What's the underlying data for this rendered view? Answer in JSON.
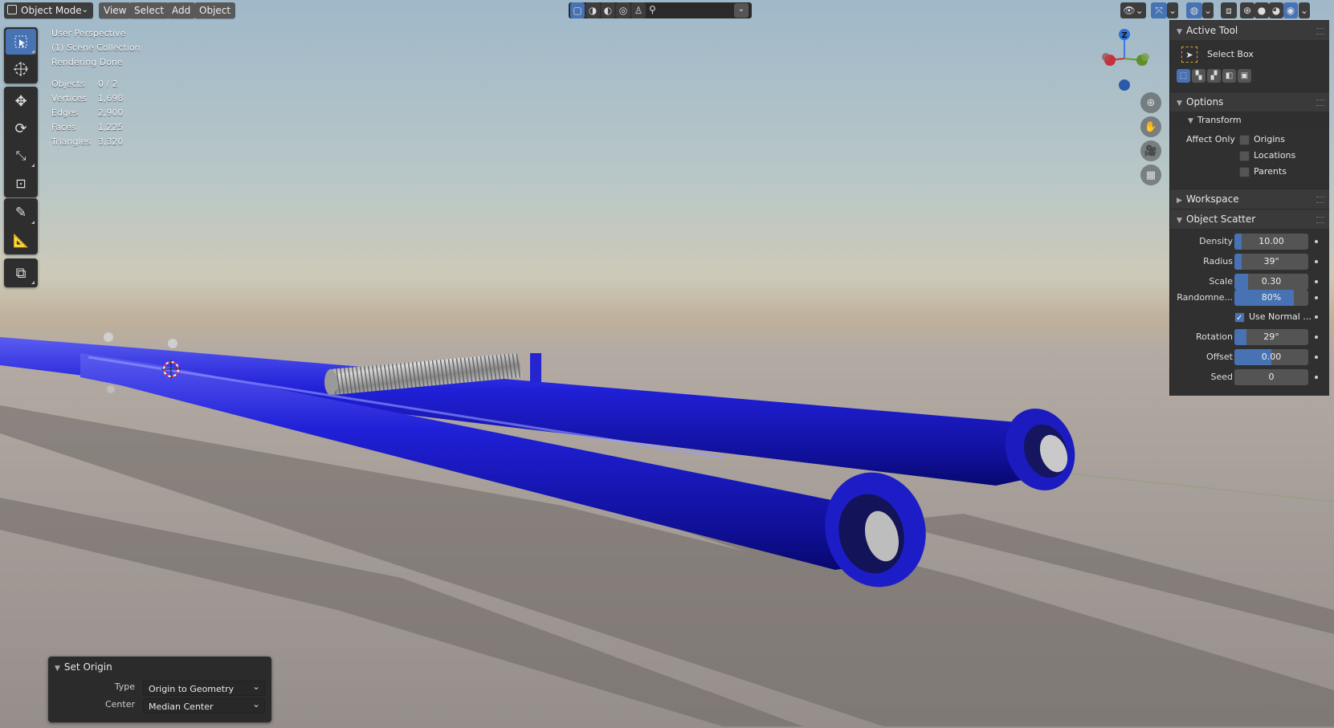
{
  "header": {
    "mode_label": "Object Mode",
    "menu": [
      "View",
      "Select",
      "Add",
      "Object"
    ]
  },
  "overlay": {
    "perspective": "User Perspective",
    "collection": "(1) Scene Collection",
    "status": "Rendering Done",
    "stats": [
      {
        "label": "Objects",
        "value": "0 / 2"
      },
      {
        "label": "Vertices",
        "value": "1,698"
      },
      {
        "label": "Edges",
        "value": "2,900"
      },
      {
        "label": "Faces",
        "value": "1,225"
      },
      {
        "label": "Triangles",
        "value": "3,320"
      }
    ]
  },
  "gizmo": {
    "z_label": "Z"
  },
  "npanel": {
    "active_tool_title": "Active Tool",
    "tool_name": "Select Box",
    "options_title": "Options",
    "transform_title": "Transform",
    "affect_only_label": "Affect Only",
    "affect_only": [
      {
        "label": "Origins",
        "checked": false
      },
      {
        "label": "Locations",
        "checked": false
      },
      {
        "label": "Parents",
        "checked": false
      }
    ],
    "workspace_title": "Workspace",
    "scatter_title": "Object Scatter",
    "scatter": [
      {
        "label": "Density",
        "value": "10.00",
        "fill": 0.1
      },
      {
        "label": "Radius",
        "value": "39\"",
        "fill": 0.1
      },
      {
        "label": "Scale",
        "value": "0.30",
        "fill": 0.18
      },
      {
        "label": "Randomne...",
        "value": "80%",
        "fill": 0.8
      },
      {
        "label": "Use Normal ...",
        "checkbox": true
      },
      {
        "label": "Rotation",
        "value": "29°",
        "fill": 0.16
      },
      {
        "label": "Offset",
        "value": "0.00",
        "fill": 0.5
      },
      {
        "label": "Seed",
        "value": "0",
        "fill": 0
      }
    ]
  },
  "set_origin": {
    "title": "Set Origin",
    "type_label": "Type",
    "type_value": "Origin to Geometry",
    "center_label": "Center",
    "center_value": "Median Center"
  },
  "colors": {
    "accent": "#4772b3",
    "tube": "#1a1ad0",
    "panel": "#303030"
  }
}
